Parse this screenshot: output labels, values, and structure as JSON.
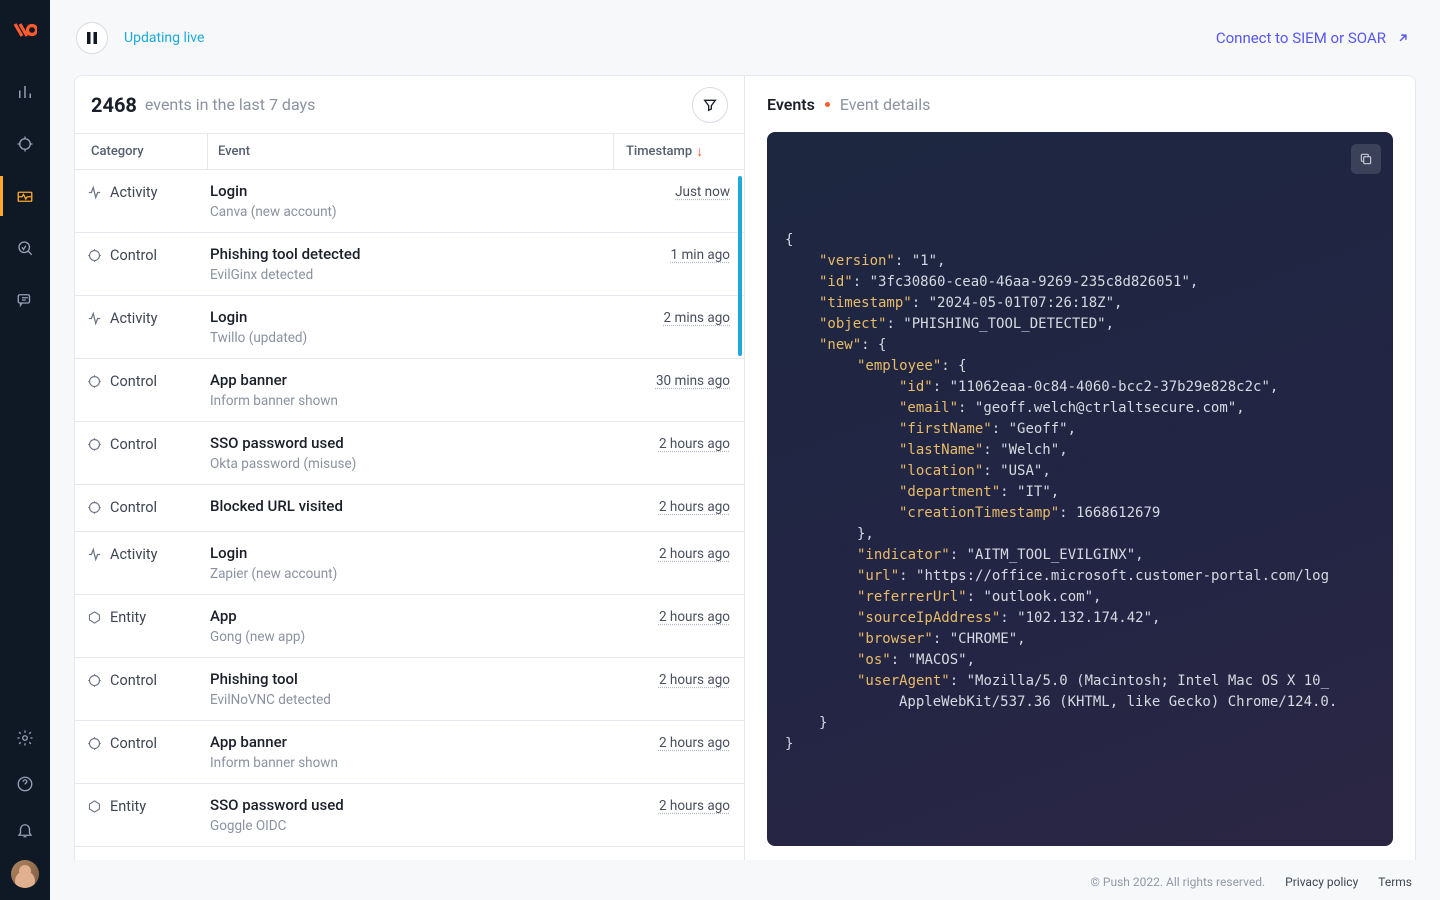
{
  "topbar": {
    "live_label": "Updating live",
    "connect_label": "Connect to SIEM or SOAR"
  },
  "events_panel": {
    "count": "2468",
    "count_label": "events in the last 7 days",
    "col_category": "Category",
    "col_event": "Event",
    "col_timestamp": "Timestamp",
    "rows": [
      {
        "cat": "Activity",
        "icon": "activity",
        "title": "Login",
        "sub": "Canva (new account)",
        "ts": "Just now"
      },
      {
        "cat": "Control",
        "icon": "control",
        "title": "Phishing tool detected",
        "sub": "EvilGinx detected",
        "ts": "1 min ago"
      },
      {
        "cat": "Activity",
        "icon": "activity",
        "title": "Login",
        "sub": "Twillo (updated)",
        "ts": "2 mins ago"
      },
      {
        "cat": "Control",
        "icon": "control",
        "title": "App banner",
        "sub": "Inform banner shown",
        "ts": "30 mins ago"
      },
      {
        "cat": "Control",
        "icon": "control",
        "title": "SSO password used",
        "sub": "Okta password (misuse)",
        "ts": "2 hours ago"
      },
      {
        "cat": "Control",
        "icon": "control",
        "title": "Blocked URL visited",
        "sub": "",
        "ts": "2 hours ago"
      },
      {
        "cat": "Activity",
        "icon": "activity",
        "title": "Login",
        "sub": "Zapier (new account)",
        "ts": "2 hours ago"
      },
      {
        "cat": "Entity",
        "icon": "entity",
        "title": "App",
        "sub": "Gong (new app)",
        "ts": "2 hours ago"
      },
      {
        "cat": "Control",
        "icon": "control",
        "title": "Phishing tool",
        "sub": "EvilNoVNC detected",
        "ts": "2 hours ago"
      },
      {
        "cat": "Control",
        "icon": "control",
        "title": "App banner",
        "sub": "Inform banner shown",
        "ts": "2 hours ago"
      },
      {
        "cat": "Entity",
        "icon": "entity",
        "title": "SSO password used",
        "sub": "Goggle OIDC",
        "ts": "2 hours ago"
      }
    ]
  },
  "detail": {
    "bc_root": "Events",
    "bc_current": "Event details",
    "json": {
      "version": "1",
      "id": "3fc30860-cea0-46aa-9269-235c8d826051",
      "timestamp": "2024-05-01T07:26:18Z",
      "object": "PHISHING_TOOL_DETECTED",
      "employee_id": "11062eaa-0c84-4060-bcc2-37b29e828c2c",
      "employee_email": "geoff.welch@ctrlaltsecure.com",
      "employee_firstName": "Geoff",
      "employee_lastName": "Welch",
      "employee_location": "USA",
      "employee_department": "IT",
      "employee_creationTimestamp": "1668612679",
      "indicator": "AITM_TOOL_EVILGINX",
      "url": "https://office.microsoft.customer-portal.com/log",
      "referrerUrl": "outlook.com",
      "sourceIpAddress": "102.132.174.42",
      "browser": "CHROME",
      "os": "MACOS",
      "userAgent1": "Mozilla/5.0 (Macintosh; Intel Mac OS X 10_",
      "userAgent2": "AppleWebKit/537.36 (KHTML, like Gecko) Chrome/124.0."
    }
  },
  "footer": {
    "copyright": "© Push 2022. All rights reserved.",
    "privacy": "Privacy policy",
    "terms": "Terms"
  }
}
